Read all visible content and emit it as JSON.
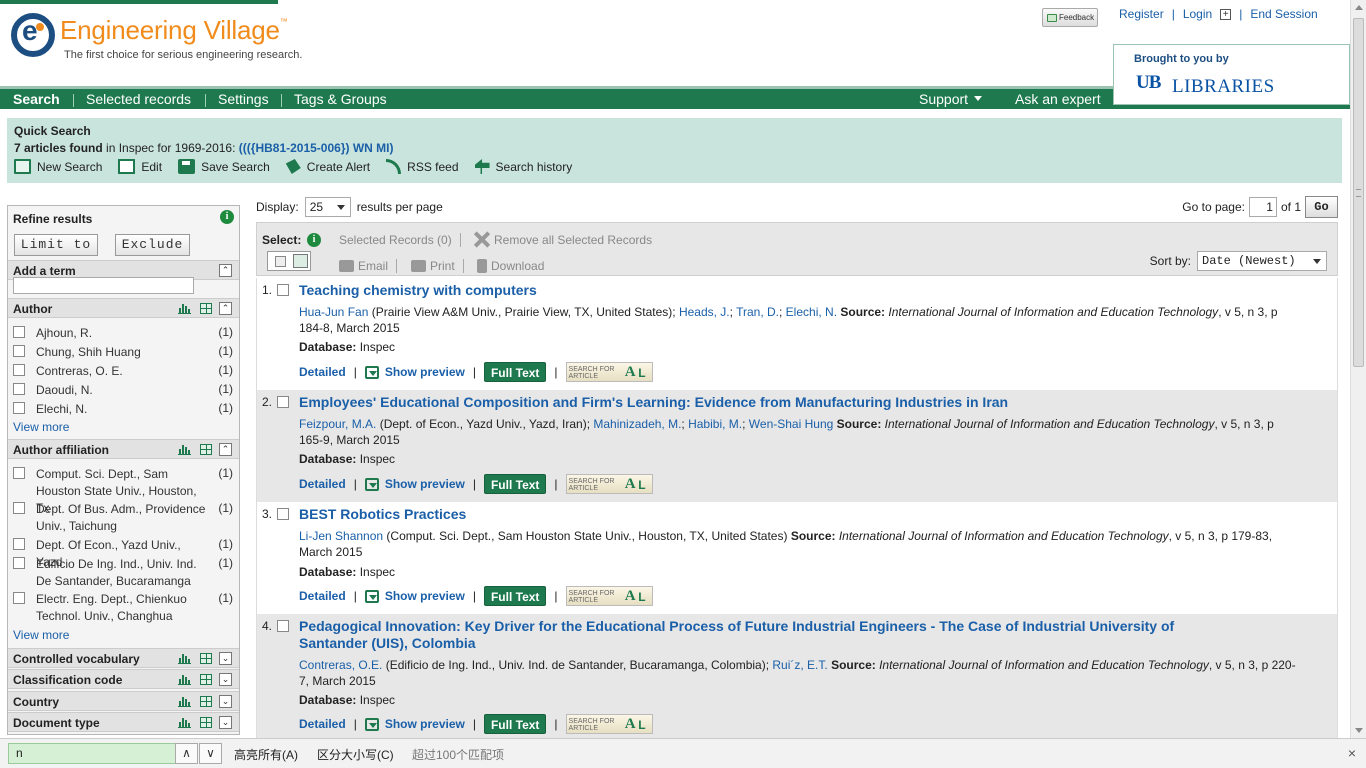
{
  "brand": {
    "name": "Engineering Village",
    "tm": "™",
    "tagline": "The first choice for serious engineering research."
  },
  "top_links": {
    "feedback": "Feedback",
    "register": "Register",
    "login": "Login",
    "end_session": "End Session"
  },
  "brought_by": {
    "label": "Brought to you by",
    "logo_mark": "UB",
    "logo_text": "LIBRARIES"
  },
  "nav": {
    "search": "Search",
    "selected_records": "Selected records",
    "settings": "Settings",
    "tags_groups": "Tags & Groups",
    "support": "Support",
    "ask_expert": "Ask an expert"
  },
  "quick_search": {
    "title": "Quick Search",
    "count": "7 articles found",
    "summary_mid": " in Inspec for 1969-2016: ",
    "query": "((({HB81-2015-006}) WN MI)",
    "actions": {
      "new_search": "New Search",
      "edit": "Edit",
      "save_search": "Save Search",
      "create_alert": "Create Alert",
      "rss": "RSS feed",
      "history": "Search history"
    }
  },
  "refine": {
    "title": "Refine results",
    "limit_to": "Limit to",
    "exclude": "Exclude",
    "add_term": "Add a term",
    "author": {
      "label": "Author",
      "items": [
        {
          "name": "Ajhoun, R.",
          "count": "(1)"
        },
        {
          "name": "Chung, Shih Huang",
          "count": "(1)"
        },
        {
          "name": "Contreras, O. E.",
          "count": "(1)"
        },
        {
          "name": "Daoudi, N.",
          "count": "(1)"
        },
        {
          "name": "Elechi, N.",
          "count": "(1)"
        }
      ],
      "view_more": "View more"
    },
    "affiliation": {
      "label": "Author affiliation",
      "items": [
        {
          "name": "Comput. Sci. Dept., Sam Houston State Univ., Houston, Tx",
          "count": "(1)"
        },
        {
          "name": "Dept. Of Bus. Adm., Providence Univ., Taichung",
          "count": "(1)"
        },
        {
          "name": "Dept. Of Econ., Yazd Univ., Yazd",
          "count": "(1)"
        },
        {
          "name": "Edificio De Ing. Ind., Univ. Ind. De Santander, Bucaramanga",
          "count": "(1)"
        },
        {
          "name": "Electr. Eng. Dept., Chienkuo Technol. Univ., Changhua",
          "count": "(1)"
        }
      ],
      "view_more": "View more"
    },
    "collapsed": [
      "Controlled vocabulary",
      "Classification code",
      "Country",
      "Document type"
    ]
  },
  "results_bar": {
    "display": "Display:",
    "per_page_value": "25",
    "per_page_text": "results per page",
    "goto": "Go to page:",
    "page": "1",
    "of": "of 1",
    "go": "Go",
    "select": "Select:",
    "selected_records": "Selected Records (0)",
    "remove_all": "Remove all Selected Records",
    "email": "Email",
    "print": "Print",
    "download": "Download",
    "sort_by": "Sort by:",
    "sort_value": "Date (Newest)"
  },
  "records": [
    {
      "num": "1.",
      "title": "Teaching chemistry with computers",
      "authors": [
        {
          "name": "Hua-Jun Fan",
          "aff": " (Prairie View A&M Univ., Prairie View, TX, United States); "
        },
        {
          "name": "Heads, J.",
          "aff": "; "
        },
        {
          "name": "Tran, D.",
          "aff": "; "
        },
        {
          "name": "Elechi, N.",
          "aff": " "
        }
      ],
      "source_label": "Source:",
      "source": "International Journal of Information and Education Technology",
      "source_detail": ", v 5, n 3, p 184-8, March 2015",
      "db_label": "Database:",
      "db": "Inspec"
    },
    {
      "num": "2.",
      "title": "Employees' Educational Composition and Firm's Learning: Evidence from Manufacturing Industries in Iran",
      "authors": [
        {
          "name": "Feizpour, M.A.",
          "aff": " (Dept. of Econ., Yazd Univ., Yazd, Iran); "
        },
        {
          "name": "Mahinizadeh, M.",
          "aff": "; "
        },
        {
          "name": "Habibi, M.",
          "aff": "; "
        },
        {
          "name": "Wen-Shai Hung",
          "aff": " "
        }
      ],
      "source_label": "Source:",
      "source": "International Journal of Information and Education Technology",
      "source_detail": ", v 5, n 3, p 165-9, March 2015",
      "db_label": "Database:",
      "db": "Inspec"
    },
    {
      "num": "3.",
      "title": "BEST Robotics Practices",
      "authors": [
        {
          "name": "Li-Jen Shannon",
          "aff": " (Comput. Sci. Dept., Sam Houston State Univ., Houston, TX, United States) "
        }
      ],
      "source_label": "Source:",
      "source": "International Journal of Information and Education Technology",
      "source_detail": ", v 5, n 3, p 179-83, March 2015",
      "db_label": "Database:",
      "db": "Inspec"
    },
    {
      "num": "4.",
      "title": "Pedagogical Innovation: Key Driver for the Educational Process of Future Industrial Engineers - The Case of Industrial University of Santander (UIS), Colombia",
      "authors": [
        {
          "name": "Contreras, O.E.",
          "aff": " (Edificio de Ing. Ind., Univ. Ind. de Santander, Bucaramanga, Colombia); "
        },
        {
          "name": "Rui´z, E.T.",
          "aff": " "
        }
      ],
      "source_label": "Source:",
      "source": "International Journal of Information and Education Technology",
      "source_detail": ", v 5, n 3, p 220-7, March 2015",
      "db_label": "Database:",
      "db": "Inspec"
    }
  ],
  "record_links": {
    "detailed": "Detailed",
    "show_preview": "Show preview",
    "full_text": "Full Text",
    "sfa_top": "SEARCH FOR",
    "sfa_bottom": "ARTICLE",
    "sfa_a": "A",
    "sfa_l": "L"
  },
  "findbar": {
    "value": "n",
    "up": "∧",
    "down": "∨",
    "highlight_all": "高亮所有(A)",
    "match_case": "区分大小写(C)",
    "status": "超过100个匹配项",
    "close": "×"
  }
}
